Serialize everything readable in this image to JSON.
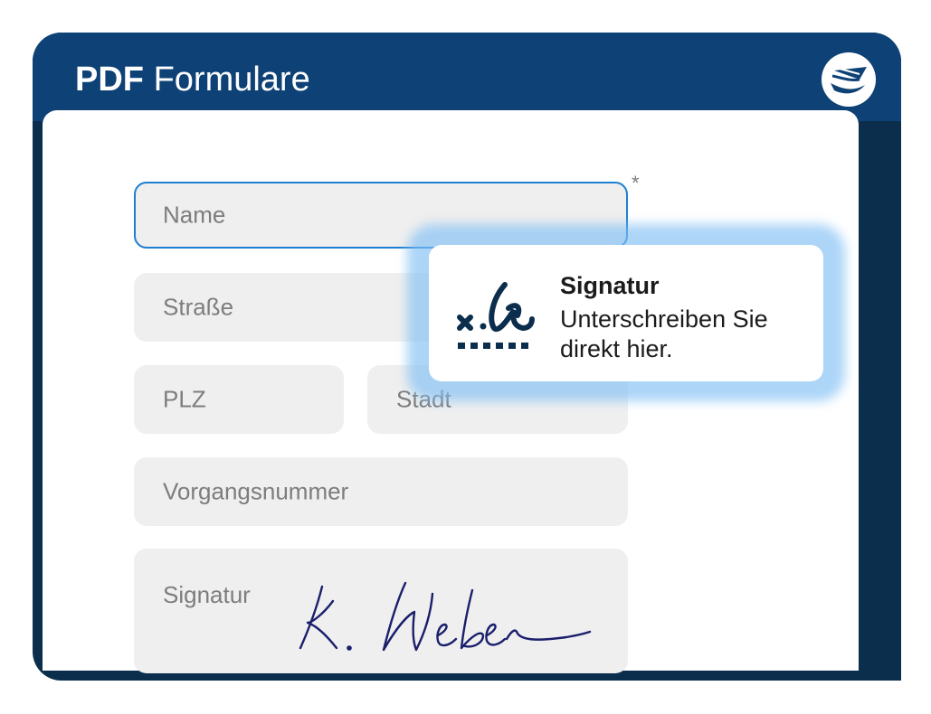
{
  "header": {
    "title_bold": "PDF",
    "title_rest": "Formulare"
  },
  "form": {
    "required_marker": "*",
    "fields": {
      "name": "Name",
      "strasse": "Straße",
      "plz": "PLZ",
      "stadt": "Stadt",
      "vorgangsnummer": "Vorgangsnummer",
      "signatur": "Signatur"
    }
  },
  "tooltip": {
    "title": "Signatur",
    "text": "Unterschreiben Sie direkt hier."
  },
  "colors": {
    "header_bg": "#0e4276",
    "window_bg": "#0b2e4c",
    "accent": "#1e7fd0",
    "field_bg": "#efefef",
    "signature_ink": "#1a1f6b"
  },
  "icons": {
    "logo": "paper-plane-logo-icon",
    "signature": "signature-icon"
  }
}
